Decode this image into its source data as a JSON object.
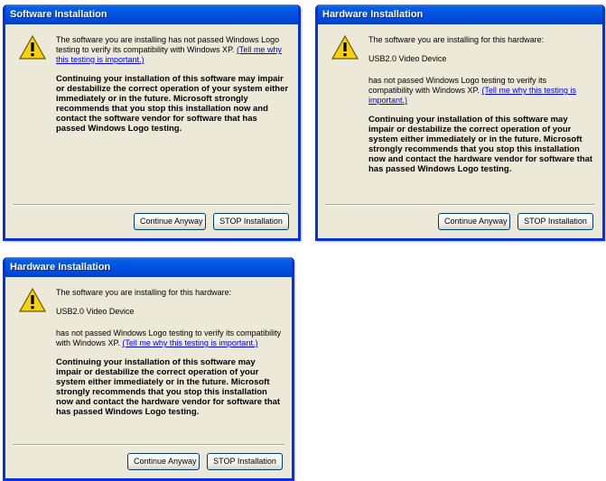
{
  "dialogs": [
    {
      "title": "Software Installation",
      "intro": "The software you are installing has not passed Windows Logo testing to verify its compatibility with Windows XP.",
      "link": "(Tell me why this testing is important.)",
      "warning": "Continuing your installation of this software may impair or destabilize the correct operation of your system either immediately or in the future. Microsoft strongly recommends that you stop this installation now and contact the software vendor for software that has passed Windows Logo testing.",
      "continue_label": "Continue Anyway",
      "stop_label": "STOP Installation"
    },
    {
      "title": "Hardware Installation",
      "intro": "The software you are installing for this hardware:",
      "device": "USB2.0 Video Device",
      "intro2": "has not passed Windows Logo testing to verify its compatibility with Windows XP.",
      "link": "(Tell me why this testing is important.)",
      "warning": "Continuing your installation of this software may impair or destabilize the correct operation of your system either immediately or in the future. Microsoft strongly recommends that you stop this installation now and contact the hardware vendor for software that has passed Windows Logo testing.",
      "continue_label": "Continue Anyway",
      "stop_label": "STOP Installation"
    },
    {
      "title": "Hardware Installation",
      "intro": "The software you are installing for this hardware:",
      "device": "USB2.0 Video Device",
      "intro2": "has not passed Windows Logo testing to verify its compatibility with Windows XP.",
      "link": "(Tell me why this testing is important.)",
      "warning": "Continuing your installation of this software may impair or destabilize the correct operation of your system either immediately or in the future. Microsoft strongly recommends that you stop this installation now and contact the hardware vendor for software that has passed Windows Logo testing.",
      "continue_label": "Continue Anyway",
      "stop_label": "STOP Installation"
    }
  ],
  "colors": {
    "titlebar": "#0054e3",
    "dialog_bg": "#ece9d8",
    "border": "#0831d9",
    "link": "#0000ee",
    "warning_icon": "#f5d10f"
  },
  "icons": {
    "warning": "warning-icon"
  }
}
